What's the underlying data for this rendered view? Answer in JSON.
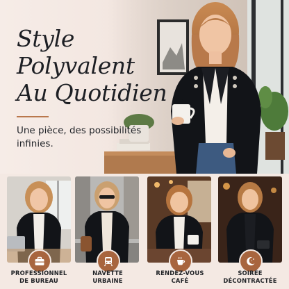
{
  "hero": {
    "headline_lines": [
      "Style",
      "Polyvalent",
      "Au Quotidien"
    ],
    "tagline": "Une pièce, des possibilités infinies."
  },
  "panels": [
    {
      "line1": "PROFESSIONNEL",
      "line2": "DE BUREAU",
      "icon": "briefcase-icon"
    },
    {
      "line1": "NAVETTE",
      "line2": "URBAINE",
      "icon": "tram-icon"
    },
    {
      "line1": "RENDEZ-VOUS",
      "line2": "CAFÉ",
      "icon": "coffee-cup-icon"
    },
    {
      "line1": "SOIRÉE",
      "line2": "DÉCONTRACTÉE",
      "icon": "moon-stars-icon"
    }
  ],
  "colors": {
    "accent": "#a8653e",
    "text": "#1d1f24",
    "background": "#f6ece6",
    "blazer": "#121418"
  }
}
